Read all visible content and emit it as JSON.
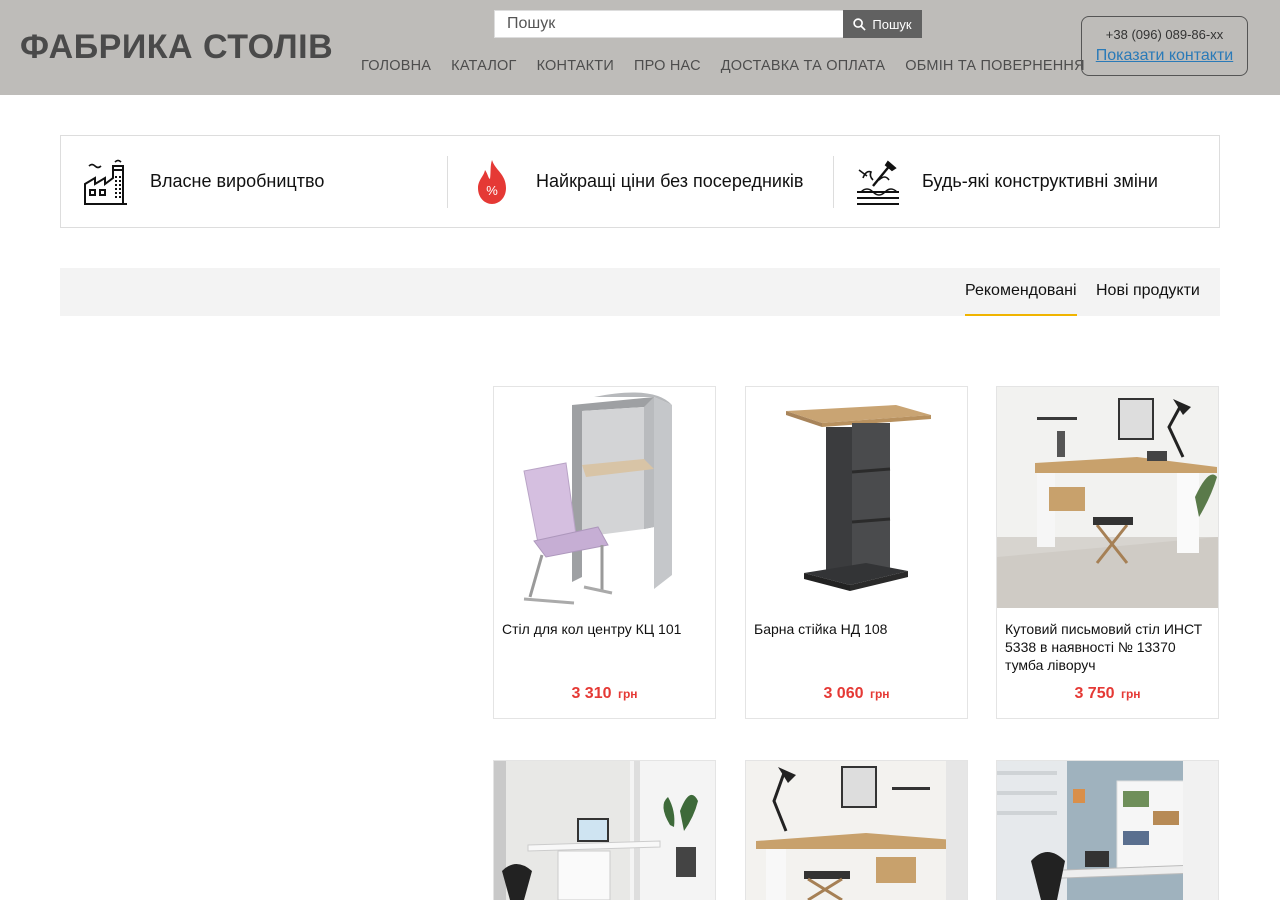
{
  "header": {
    "logo": "ФАБРИКА СТОЛІВ",
    "search_placeholder": "Пошук",
    "search_button": "Пошук",
    "nav": [
      "ГОЛОВНА",
      "КАТАЛОГ",
      "КОНТАКТИ",
      "ПРО НАС",
      "ДОСТАВКА ТА ОПЛАТА",
      "ОБМІН ТА ПОВЕРНЕННЯ"
    ],
    "phone": "+38 (096) 089-86-xx",
    "show_contacts": "Показати контакти"
  },
  "features": [
    {
      "icon": "factory-icon",
      "text": "Власне виробництво"
    },
    {
      "icon": "fire-discount-icon",
      "text": "Найкращі ціни без посередників"
    },
    {
      "icon": "wood-tools-icon",
      "text": "Будь-які конструктивні зміни"
    }
  ],
  "tabs": [
    {
      "label": "Рекомендовані",
      "active": true
    },
    {
      "label": "Нові продукти",
      "active": false
    }
  ],
  "products": [
    {
      "name": "Стіл для кол центру КЦ 101",
      "price": "3 310",
      "currency": "грн"
    },
    {
      "name": "Барна стійка НД 108",
      "price": "3 060",
      "currency": "грн"
    },
    {
      "name": "Кутовий письмовий стіл ИНСТ 5338 в наявності № 13370 тумба ліворуч",
      "price": "3 750",
      "currency": "грн"
    },
    {
      "name": "",
      "price": "",
      "currency": ""
    },
    {
      "name": "",
      "price": "",
      "currency": ""
    },
    {
      "name": "",
      "price": "",
      "currency": ""
    }
  ],
  "colors": {
    "header_bg": "#bebcb9",
    "price": "#e53935",
    "tab_underline": "#f0b400",
    "link": "#2a7ab8"
  }
}
